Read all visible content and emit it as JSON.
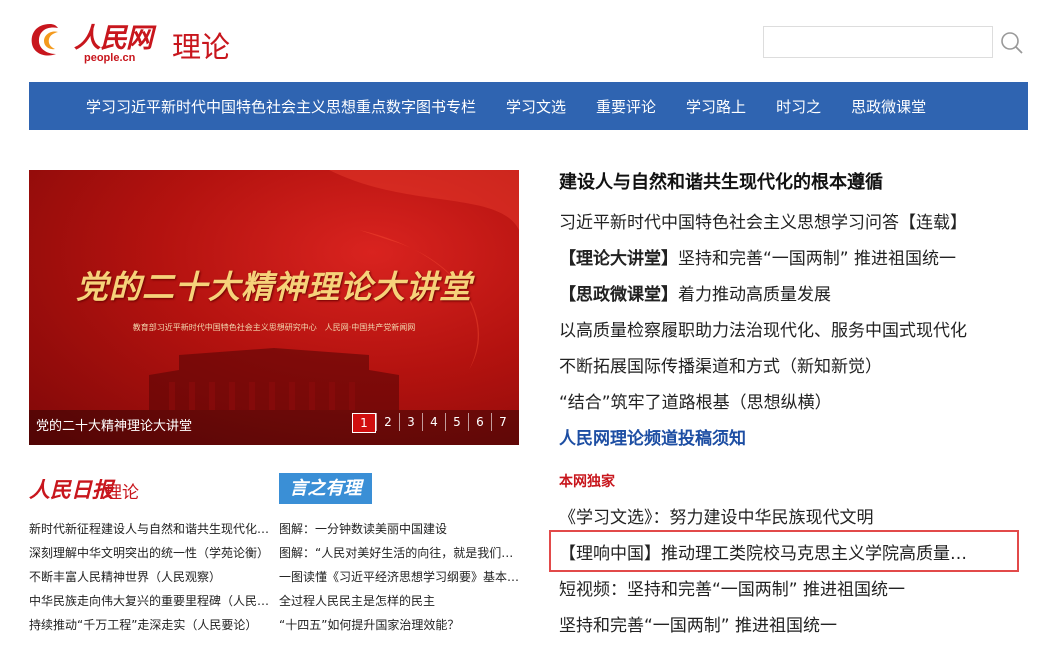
{
  "header": {
    "logo_cn": "人民网",
    "logo_en": "people.cn",
    "section": "理论",
    "search_placeholder": ""
  },
  "nav": {
    "items": [
      "学习习近平新时代中国特色社会主义思想重点数字图书专栏",
      "学习文选",
      "重要评论",
      "学习路上",
      "时习之",
      "思政微课堂"
    ]
  },
  "carousel": {
    "banner_title": "党的二十大精神理论大讲堂",
    "banner_sub": "教育部习近平新时代中国特色社会主义思想研究中心　人民网·中国共产党新闻网",
    "caption": "党的二十大精神理论大讲堂",
    "pages": [
      "1",
      "2",
      "3",
      "4",
      "5",
      "6",
      "7"
    ],
    "active_page": "1"
  },
  "bottom_left": {
    "rmrb_logo": "人民日报",
    "rmrb_sub": "理论",
    "yanzheng": "言之有理",
    "col1": [
      "新时代新征程建设人与自然和谐共生现代化…",
      "深刻理解中华文明突出的统一性（学苑论衡）",
      "不断丰富人民精神世界（人民观察）",
      "中华民族走向伟大复兴的重要里程碑（人民…",
      "持续推动“千万工程”走深走实（人民要论）"
    ],
    "col2": [
      "图解：一分钟数读美丽中国建设",
      "图解：“人民对美好生活的向往，就是我们…",
      "一图读懂《习近平经济思想学习纲要》基本…",
      "全过程人民民主是怎样的民主",
      "“十四五”如何提升国家治理效能？"
    ]
  },
  "right": {
    "headline": "建设人与自然和谐共生现代化的根本遵循",
    "list": [
      {
        "prefix": "",
        "text": "习近平新时代中国特色社会主义思想学习问答【连载】"
      },
      {
        "prefix": "【理论大讲堂】",
        "text": "坚持和完善“一国两制”  推进祖国统一"
      },
      {
        "prefix": "【思政微课堂】",
        "text": "着力推动高质量发展"
      },
      {
        "prefix": "",
        "text": "以高质量检察履职助力法治现代化、服务中国式现代化"
      },
      {
        "prefix": "",
        "text": "不断拓展国际传播渠道和方式（新知新觉）"
      },
      {
        "prefix": "",
        "text": "“结合”筑牢了道路根基（思想纵横）"
      }
    ],
    "notice_link": "人民网理论频道投稿须知",
    "section_label": "本网独家",
    "list2": [
      "《学习文选》：努力建设中华民族现代文明",
      "【理响中国】推动理工类院校马克思主义学院高质量…",
      "短视频：坚持和完善“一国两制”  推进祖国统一",
      "坚持和完善“一国两制”  推进祖国统一"
    ]
  },
  "colors": {
    "brand_red": "#c8161d",
    "nav_blue": "#2f64b1",
    "link_blue": "#1d4ea3",
    "highlight_border": "#e24a4a"
  }
}
